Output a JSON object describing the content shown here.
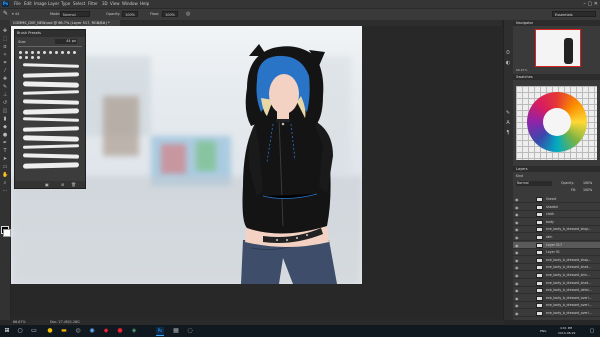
{
  "menubar": {
    "app_logo": "Ps",
    "items": [
      "File",
      "Edit",
      "Image",
      "Layer",
      "Type",
      "Select",
      "Filter",
      "3D",
      "View",
      "Window",
      "Help"
    ],
    "window_controls": "–  ▢  ✕"
  },
  "options_bar": {
    "mode_label": "Mode:",
    "mode_value": "Normal",
    "opacity_label": "Opacity:",
    "opacity_value": "100%",
    "flow_label": "Flow:",
    "flow_value": "100%",
    "workspace": "Essentials"
  },
  "document": {
    "tab_title": "COMMS_DVE_NEW.psd @ 66.7% (Layer 517, RGB/8#) *"
  },
  "brush_panel": {
    "title": "Brush Presets",
    "size_label": "Size:",
    "size_value": "44 px",
    "strokes": [
      1,
      2,
      3,
      4,
      5,
      6,
      7,
      8,
      9,
      10,
      11,
      12
    ]
  },
  "right_panels": {
    "navigator_title": "Navigator",
    "navigator_zoom": "66.67%",
    "swatches_title": "Swatches",
    "layers_title": "Layers",
    "kind_label": "Kind",
    "blend_mode": "Normal",
    "opacity_label": "Opacity:",
    "opacity_value": "100%",
    "fill_label": "Fill:",
    "fill_value": "100%",
    "layers": [
      {
        "name": "lineart",
        "selected": false
      },
      {
        "name": "shaded",
        "selected": false
      },
      {
        "name": "cloth",
        "selected": false
      },
      {
        "name": "body",
        "selected": false
      },
      {
        "name": "eve_body_b_dressed_shap...",
        "selected": false
      },
      {
        "name": "skin",
        "selected": false
      },
      {
        "name": "Layer 517",
        "selected": true
      },
      {
        "name": "Layer 91",
        "selected": false
      },
      {
        "name": "eve_body_b_dressed_shap...",
        "selected": false
      },
      {
        "name": "eve_body_b_dressed_shad...",
        "selected": false
      },
      {
        "name": "eve_body_b_dressed_shin...",
        "selected": false
      },
      {
        "name": "eve_body_b_dressed_shad...",
        "selected": false
      },
      {
        "name": "eve_body_b_dressed_detai...",
        "selected": false
      },
      {
        "name": "eve_body_b_dressed_overl...",
        "selected": false
      },
      {
        "name": "eve_body_b_dressed_overl...",
        "selected": false
      },
      {
        "name": "eve_body_b_dressed_overl...",
        "selected": false
      }
    ]
  },
  "statusbar": {
    "zoom": "66.67%",
    "doc_size": "Doc: 27.4M/1.26G"
  },
  "taskbar": {
    "language": "ENG",
    "time": "4:01 PM",
    "date": "2019-08-29"
  },
  "colors": {
    "hood": "#141414",
    "hair": "#2a74c8",
    "pants": "#3e4e6a",
    "skin": "#f3d2c4"
  }
}
